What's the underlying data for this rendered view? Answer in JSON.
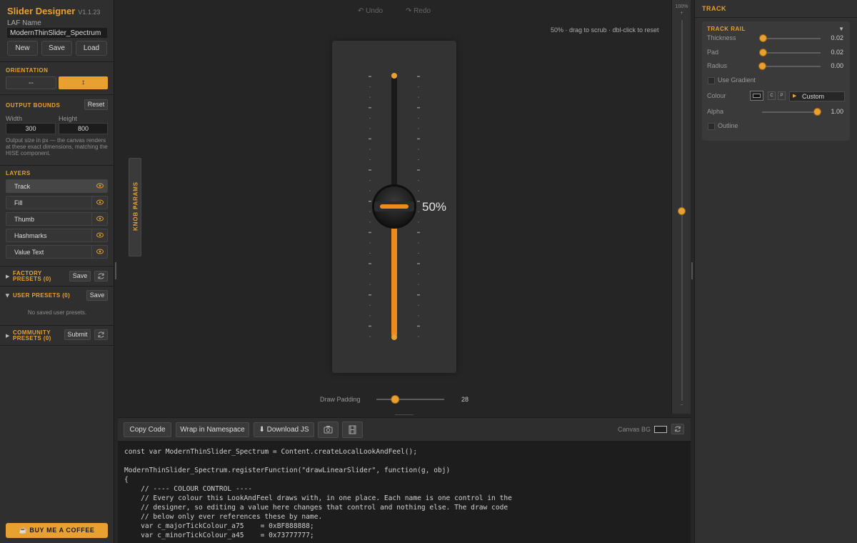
{
  "app": {
    "title": "Slider Designer",
    "version": "V1.1.23"
  },
  "laf": {
    "label": "LAF Name",
    "value": "ModernThinSlider_Spectrum"
  },
  "file_buttons": {
    "new": "New",
    "save": "Save",
    "load": "Load"
  },
  "orientation": {
    "title": "ORIENTATION",
    "horizontal": "--",
    "vertical": "↕",
    "selected": "vertical"
  },
  "output_bounds": {
    "title": "OUTPUT BOUNDS",
    "reset": "Reset",
    "width_label": "Width",
    "width": "300",
    "height_label": "Height",
    "height": "800",
    "help": "Output size in px — the canvas renders at these exact dimensions, matching the HISE component."
  },
  "layers": {
    "title": "LAYERS",
    "items": [
      {
        "label": "Track",
        "active": true
      },
      {
        "label": "Fill",
        "active": false
      },
      {
        "label": "Thumb",
        "active": false
      },
      {
        "label": "Hashmarks",
        "active": false
      },
      {
        "label": "Value Text",
        "active": false
      }
    ]
  },
  "presets": {
    "factory": {
      "title_line1": "FACTORY",
      "title_line2": "PRESETS (0)",
      "action": "Save"
    },
    "user": {
      "title": "USER PRESETS (0)",
      "action": "Save",
      "empty": "No saved user presets."
    },
    "community": {
      "title_line1": "COMMUNITY",
      "title_line2": "PRESETS (0)",
      "action": "Submit"
    }
  },
  "coffee": "☕ BUY ME A COFFEE",
  "knob_params": "KNOB PARAMS",
  "history": {
    "undo": "Undo",
    "redo": "Redo"
  },
  "canvas": {
    "hint": "50% · drag to scrub · dbl-click to reset",
    "value_text": "50%",
    "slider_value": 0.5,
    "draw_padding_label": "Draw Padding",
    "draw_padding": "28",
    "draw_padding_fraction": 0.25
  },
  "zoom": {
    "label": "100%",
    "plus": "+",
    "minus": "−",
    "level": 0.5
  },
  "toolbar": {
    "copy": "Copy Code",
    "wrap": "Wrap in Namespace",
    "download": "⬇ Download JS",
    "canvas_bg": "Canvas BG"
  },
  "code": [
    "const var ModernThinSlider_Spectrum = Content.createLocalLookAndFeel();",
    "",
    "ModernThinSlider_Spectrum.registerFunction(\"drawLinearSlider\", function(g, obj)",
    "{",
    "    // ---- COLOUR CONTROL ----",
    "    // Every colour this LookAndFeel draws with, in one place. Each name is one control in the",
    "    // designer, so editing a value here changes that control and nothing else. The draw code",
    "    // below only ever references these by name.",
    "    var c_majorTickColour_a75    = 0xBF888888;",
    "    var c_minorTickColour_a45    = 0x73777777;"
  ],
  "panel": {
    "title": "TRACK",
    "section": "TRACK RAIL",
    "collapse": "▼",
    "props": [
      {
        "label": "Thickness",
        "value": "0.02",
        "fraction": 0.02
      },
      {
        "label": "Pad",
        "value": "0.02",
        "fraction": 0.02
      },
      {
        "label": "Radius",
        "value": "0.00",
        "fraction": 0.0
      }
    ],
    "use_gradient": "Use Gradient",
    "colour_label": "Colour",
    "colour_c": "C",
    "colour_p": "P",
    "colour_mode": "Custom",
    "alpha_label": "Alpha",
    "alpha": "1.00",
    "alpha_fraction": 1.0,
    "outline": "Outline"
  },
  "colors": {
    "accent": "#e8a030",
    "fill": "#f08a1c",
    "background": "#252525"
  }
}
